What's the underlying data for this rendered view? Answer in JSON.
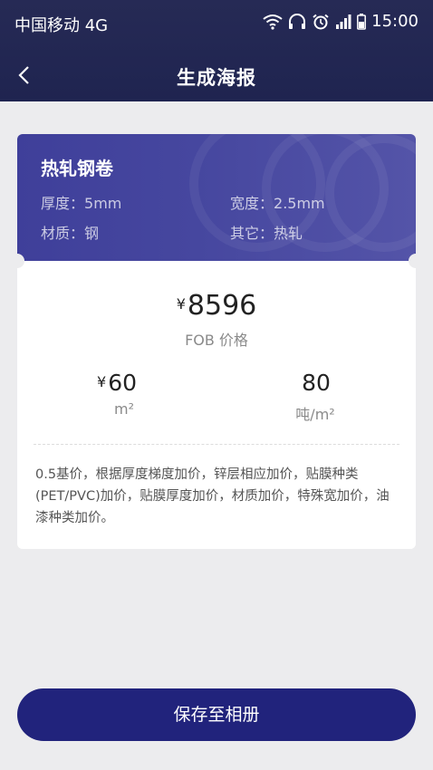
{
  "status_bar": {
    "carrier": "中国移动 4G",
    "time": "15:00",
    "icons": [
      "wifi-icon",
      "headphones-icon",
      "alarm-icon",
      "signal-icon",
      "battery-icon"
    ]
  },
  "nav": {
    "title": "生成海报",
    "back_icon": "chevron-left-icon"
  },
  "product": {
    "name": "热轧钢卷",
    "specs": [
      {
        "label": "厚度：",
        "value": "5mm"
      },
      {
        "label": "宽度：",
        "value": "2.5mm"
      },
      {
        "label": "材质：",
        "value": "钢"
      },
      {
        "label": "其它：",
        "value": "热轧"
      }
    ]
  },
  "pricing": {
    "currency": "¥",
    "main_price": "8596",
    "main_label": "FOB 价格",
    "sub_prices": [
      {
        "currency": "¥",
        "value": "60",
        "unit": "m²"
      },
      {
        "currency": "",
        "value": "80",
        "unit": "吨/m²"
      }
    ]
  },
  "note": "0.5基价，根据厚度梯度加价，锌层相应加价，贴膜种类(PET/PVC)加价，贴膜厚度加价，材质加价，特殊宽加价，油漆种类加价。",
  "actions": {
    "save_label": "保存至相册"
  },
  "colors": {
    "header_bg": "#1f2450",
    "card_header_bg": "#46479f",
    "button_bg": "#21237c",
    "page_bg": "#ececee"
  }
}
